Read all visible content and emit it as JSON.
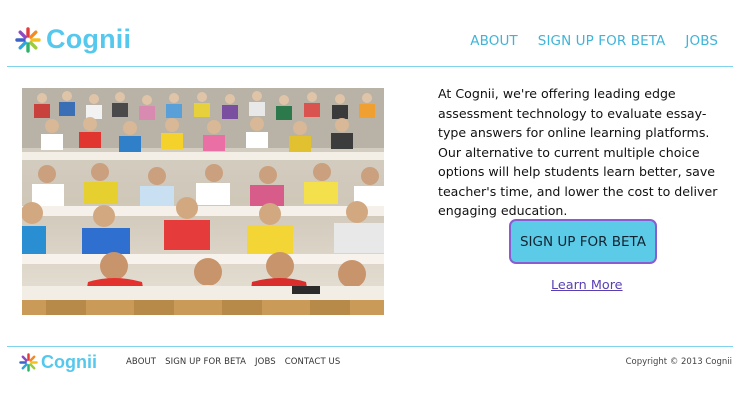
{
  "brand": {
    "name": "Cognii"
  },
  "header": {
    "nav": [
      {
        "label": "ABOUT"
      },
      {
        "label": "SIGN UP FOR BETA"
      },
      {
        "label": "JOBS"
      }
    ]
  },
  "colors": {
    "accent": "#55c8ee",
    "nav_link": "#3fb4d9",
    "cta_background": "#5ccbe8",
    "cta_border": "#8b5ccf",
    "learn_more_link": "#5a3fb3",
    "divider": "#7fd3ec"
  },
  "hero": {
    "image": "classroom-students-writing-photo",
    "intro": "At Cognii, we're offering leading edge assessment technology to evaluate essay-type answers for online learning platforms. Our alternative to current multiple choice options will help students learn better, save teacher's time, and lower the cost to deliver engaging education.",
    "cta_label": "SIGN UP FOR BETA",
    "learn_more_label": "Learn More"
  },
  "footer": {
    "nav": [
      {
        "label": "ABOUT"
      },
      {
        "label": "SIGN UP FOR BETA"
      },
      {
        "label": "JOBS"
      },
      {
        "label": "CONTACT US"
      }
    ],
    "copyright": "Copyright © 2013 Cognii"
  }
}
